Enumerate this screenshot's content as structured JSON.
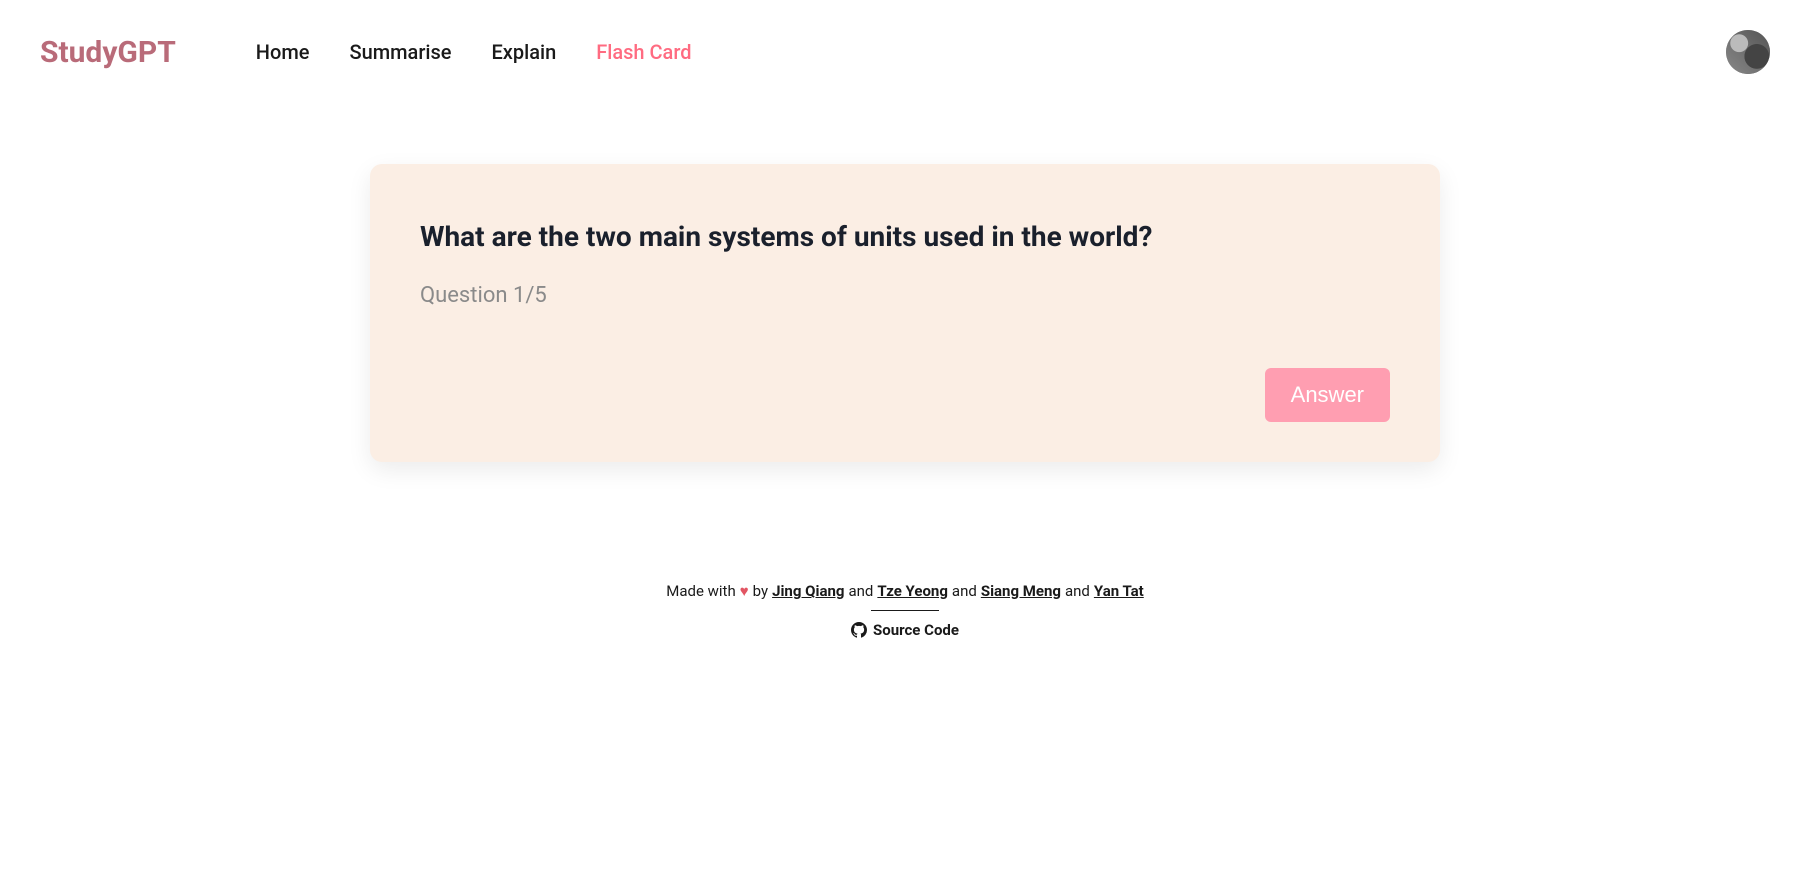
{
  "header": {
    "logo": "StudyGPT",
    "nav": {
      "home": "Home",
      "summarise": "Summarise",
      "explain": "Explain",
      "flashcard": "Flash Card"
    }
  },
  "card": {
    "question": "What are the two main systems of units used in the world?",
    "progress": "Question 1/5",
    "answer_btn": "Answer"
  },
  "footer": {
    "made_with": "Made with",
    "by": "by",
    "and": "and",
    "authors": {
      "a1": "Jing Qiang",
      "a2": "Tze Yeong",
      "a3": "Siang Meng",
      "a4": "Yan Tat"
    },
    "source_code": "Source Code"
  }
}
